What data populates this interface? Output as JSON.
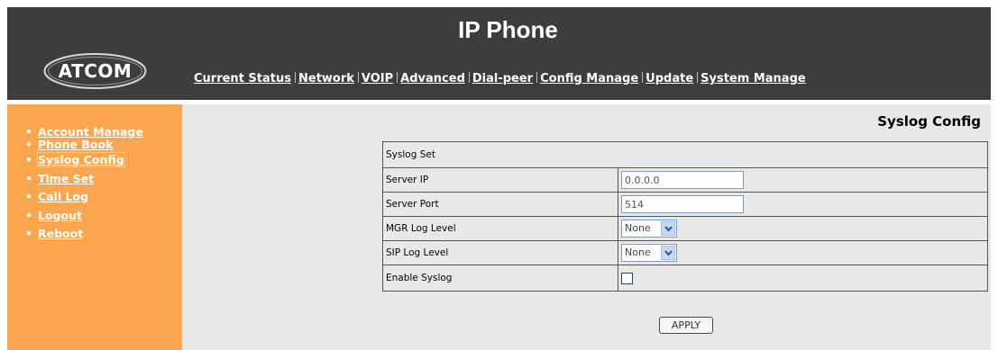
{
  "header": {
    "logo_text": "ATCOM",
    "title": "IP Phone",
    "nav": [
      "Current Status",
      "Network",
      "VOIP",
      "Advanced",
      "Dial-peer",
      "Config Manage",
      "Update",
      "System Manage"
    ]
  },
  "sidebar": {
    "items": [
      "Account Manage",
      "Phone Book",
      "Syslog Config",
      "Time Set",
      "Call Log",
      "Logout",
      "Reboot"
    ],
    "active": "Syslog Config"
  },
  "main": {
    "page_title": "Syslog Config",
    "section_header": "Syslog Set",
    "fields": {
      "server_ip": {
        "label": "Server IP",
        "value": "0.0.0.0"
      },
      "server_port": {
        "label": "Server Port",
        "value": "514"
      },
      "mgr_log_level": {
        "label": "MGR Log Level",
        "value": "None"
      },
      "sip_log_level": {
        "label": "SIP Log Level",
        "value": "None"
      },
      "enable_syslog": {
        "label": "Enable Syslog",
        "checked": false
      }
    },
    "apply_label": "APPLY"
  },
  "colors": {
    "header_bg": "#3d3d3d",
    "sidebar_bg": "#fca64f",
    "content_bg": "#e8e8e8"
  }
}
